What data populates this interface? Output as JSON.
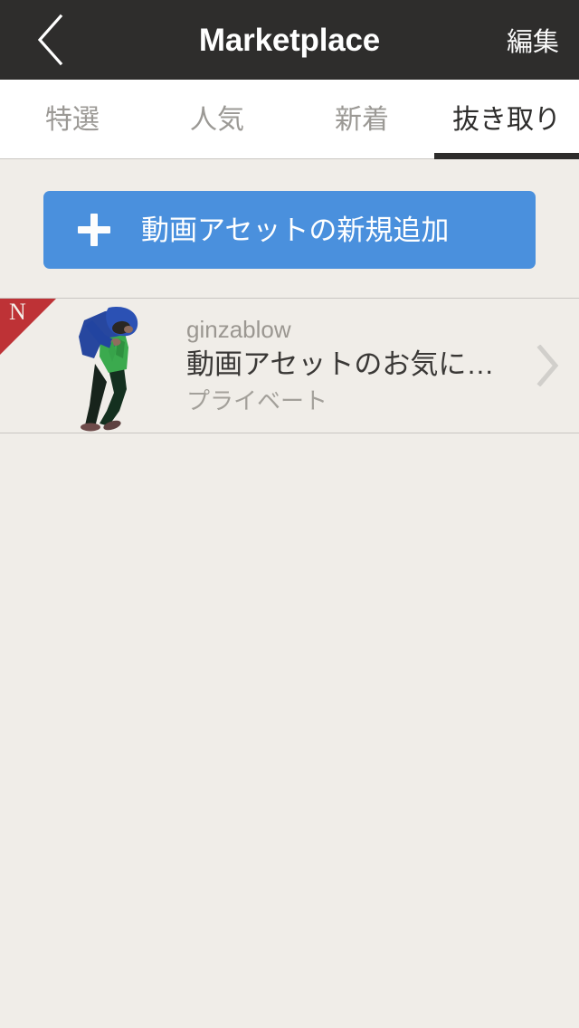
{
  "navbar": {
    "back_icon": "chevron-left-icon",
    "title": "Marketplace",
    "edit_label": "編集",
    "background_color": "#2E2D2C",
    "title_color": "#FFFFFF"
  },
  "tabs": {
    "items": [
      {
        "label": "特選",
        "active": false
      },
      {
        "label": "人気",
        "active": false
      },
      {
        "label": "新着",
        "active": false
      },
      {
        "label": "抜き取り",
        "active": true
      }
    ],
    "active_index": 3,
    "active_color": "#2E2D2C",
    "inactive_color": "#9B9995",
    "background_color": "#FFFFFF"
  },
  "add_button": {
    "icon": "plus-icon",
    "label": "動画アセットの新規追加",
    "background_color": "#4A90DD",
    "text_color": "#FFFFFF"
  },
  "asset_list": {
    "items": [
      {
        "badge": "N",
        "badge_color": "#BE3236",
        "author": "ginzablow",
        "title": "動画アセットのお気に…",
        "privacy": "プライベート",
        "thumbnail": "person-cutout-thumbnail",
        "chevron": "chevron-right-icon"
      }
    ]
  },
  "page": {
    "background_color": "#F0EDE8",
    "separator_color": "#C9C6C2"
  }
}
